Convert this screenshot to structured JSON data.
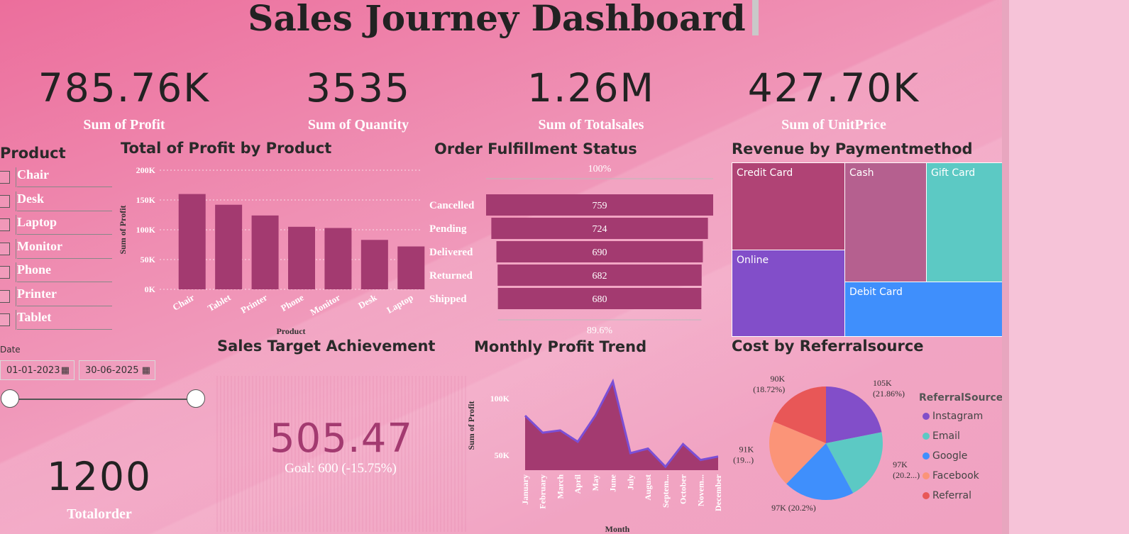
{
  "title": "Sales Journey Dashboard",
  "kpis": [
    {
      "value": "785.76K",
      "label": "Sum of Profit"
    },
    {
      "value": "3535",
      "label": "Sum of Quantity"
    },
    {
      "value": "1.26M",
      "label": "Sum of Totalsales"
    },
    {
      "value": "427.70K",
      "label": "Sum of UnitPrice"
    }
  ],
  "product_slicer": {
    "title": "Product",
    "items": [
      "Chair",
      "Desk",
      "Laptop",
      "Monitor",
      "Phone",
      "Printer",
      "Tablet"
    ]
  },
  "date_slicer": {
    "title": "Date",
    "start": "01-01-2023",
    "end": "30-06-2025",
    "calendar_icon": "calendar-icon"
  },
  "totalorder": {
    "value": "1200",
    "label": "Totalorder"
  },
  "gauge": {
    "title": "Sales Target Achievement",
    "value": "505.47",
    "goal_text": "Goal: 600 (-15.75%)"
  },
  "colors": {
    "bar": "#a33a70",
    "line": "#7b4fd6",
    "credit_card": "#b04375",
    "cash": "#b5608f",
    "gift_card": "#5cc9c4",
    "online": "#824ec9",
    "debit_card": "#3f8ffc",
    "instagram": "#824ec9",
    "email": "#5cc9c4",
    "google": "#3f8ffc",
    "facebook": "#fb9478",
    "referral": "#e85757"
  },
  "chart_data": [
    {
      "type": "bar",
      "title": "Total of Profit by Product",
      "xlabel": "Product",
      "ylabel": "Sum of Profit",
      "categories": [
        "Chair",
        "Tablet",
        "Printer",
        "Phone",
        "Monitor",
        "Desk",
        "Laptop"
      ],
      "values": [
        160000,
        142000,
        124000,
        105000,
        103000,
        83000,
        72000
      ],
      "ylim": [
        0,
        200000
      ],
      "yticks": [
        "0K",
        "50K",
        "100K",
        "150K",
        "200K"
      ],
      "ytick_values": [
        0,
        50000,
        100000,
        150000,
        200000
      ],
      "grid": true
    },
    {
      "type": "bar",
      "title": "Order Fulfillment Status",
      "categories": [
        "Cancelled",
        "Pending",
        "Delivered",
        "Returned",
        "Shipped"
      ],
      "values": [
        759,
        724,
        690,
        682,
        680
      ],
      "top_label": "100%",
      "bottom_label": "89.6%"
    },
    {
      "type": "area",
      "title": "Monthly Profit Trend",
      "xlabel": "Month",
      "ylabel": "Sum of Profit",
      "categories": [
        "January",
        "February",
        "March",
        "April",
        "May",
        "June",
        "July",
        "August",
        "Septem...",
        "October",
        "Novem...",
        "December"
      ],
      "values": [
        85000,
        70000,
        72000,
        62000,
        85000,
        115000,
        52000,
        56000,
        40000,
        60000,
        46000,
        49000
      ],
      "ylim": [
        37000,
        120000
      ],
      "yticks": [
        "50K",
        "100K"
      ],
      "ytick_values": [
        50000,
        100000
      ]
    },
    {
      "type": "heatmap",
      "title": "Revenue by Paymentmethod",
      "cells": [
        {
          "name": "Credit Card",
          "value": 0.2
        },
        {
          "name": "Cash",
          "value": 0.2
        },
        {
          "name": "Gift Card",
          "value": 0.2
        },
        {
          "name": "Online",
          "value": 0.2
        },
        {
          "name": "Debit Card",
          "value": 0.2
        }
      ]
    },
    {
      "type": "pie",
      "title": "Cost by Referralsource",
      "legend_title": "ReferralSource",
      "legend_position": "right",
      "slices": [
        {
          "name": "Instagram",
          "value": 105,
          "label": "105K\n(21.86%)"
        },
        {
          "name": "Email",
          "value": 97,
          "label": "97K\n(20.2...)"
        },
        {
          "name": "Google",
          "value": 97,
          "label": "97K (20.2%)"
        },
        {
          "name": "Facebook",
          "value": 91,
          "label": "91K\n(19...)"
        },
        {
          "name": "Referral",
          "value": 90,
          "label": "90K\n(18.72%)"
        }
      ]
    }
  ]
}
